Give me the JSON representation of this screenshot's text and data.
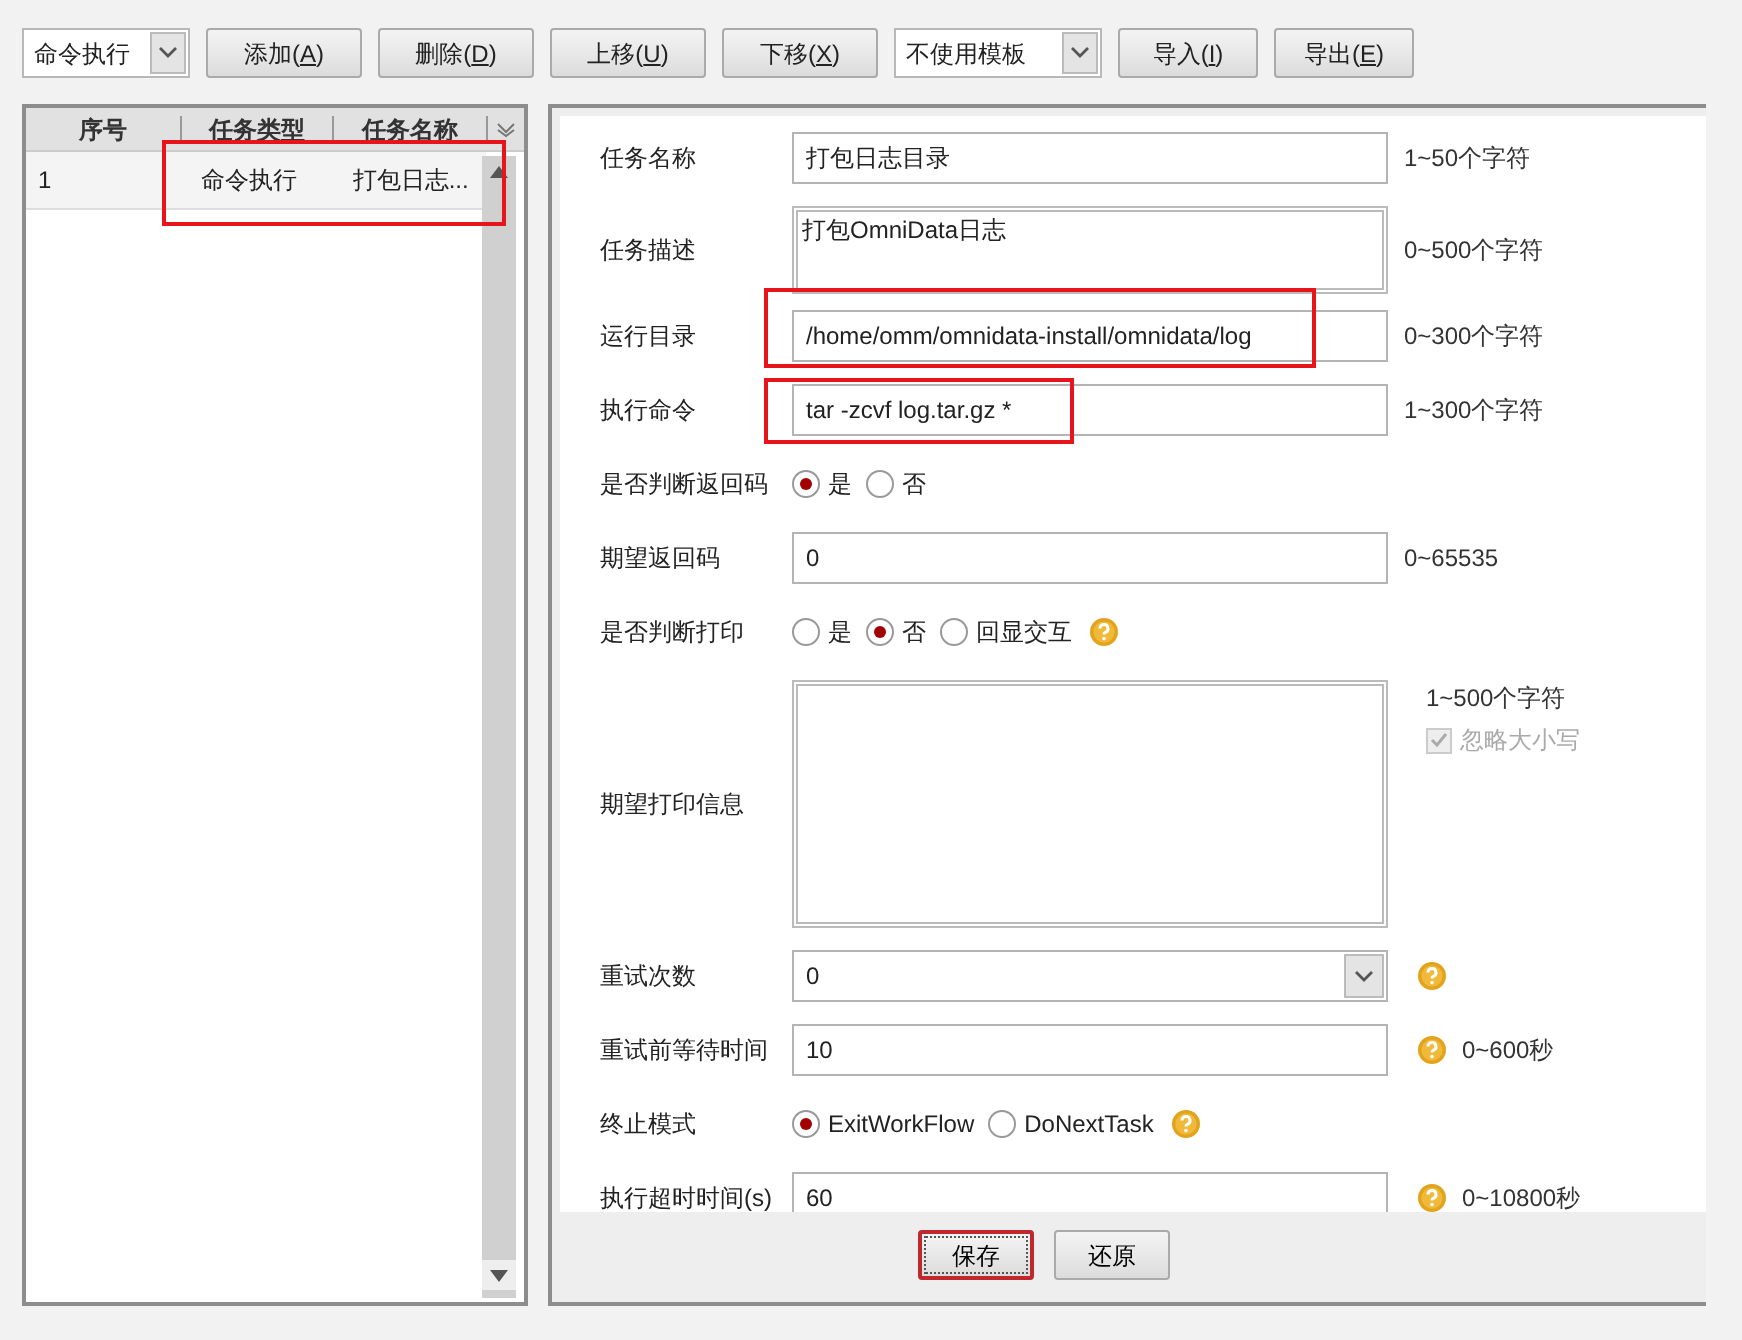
{
  "toolbar": {
    "type_select": {
      "value": "命令执行"
    },
    "buttons": [
      {
        "before": "添加(",
        "key": "A",
        "after": ")"
      },
      {
        "before": "删除(",
        "key": "D",
        "after": ")"
      },
      {
        "before": "上移(",
        "key": "U",
        "after": ")"
      },
      {
        "before": "下移(",
        "key": "X",
        "after": ")"
      }
    ],
    "template_select": {
      "value": "不使用模板"
    },
    "buttons_after": [
      {
        "before": "导入(",
        "key": "I",
        "after": ")"
      },
      {
        "before": "导出(",
        "key": "E",
        "after": ")"
      }
    ]
  },
  "task_table": {
    "columns": [
      "序号",
      "任务类型",
      "任务名称"
    ],
    "rows": [
      {
        "cells": [
          "1",
          "命令执行",
          "打包日志..."
        ],
        "selected": false,
        "annotated": true
      }
    ]
  },
  "form": {
    "rows": [
      {
        "kind": "text",
        "label": "任务名称",
        "value": "打包日志目录",
        "hint": "1~50个字符"
      },
      {
        "kind": "textarea",
        "label": "任务描述",
        "value": "打包OmniData日志",
        "hint": "0~500个字符"
      },
      {
        "kind": "text",
        "label": "运行目录",
        "value": "/home/omm/omnidata-install/omnidata/log",
        "hint": "0~300个字符",
        "annotated": true
      },
      {
        "kind": "text",
        "label": "执行命令",
        "value": "tar -zcvf log.tar.gz *",
        "hint": "1~300个字符",
        "annotated": true,
        "short_annotation": true
      },
      {
        "kind": "radio",
        "label": "是否判断返回码",
        "options": [
          {
            "label": "是",
            "selected": true
          },
          {
            "label": "否",
            "selected": false
          }
        ]
      },
      {
        "kind": "text",
        "label": "期望返回码",
        "value": "0",
        "hint": "0~65535"
      },
      {
        "kind": "radio",
        "label": "是否判断打印",
        "options": [
          {
            "label": "是",
            "selected": false
          },
          {
            "label": "否",
            "selected": true
          },
          {
            "label": "回显交互",
            "selected": false
          }
        ],
        "help": true
      },
      {
        "kind": "bigtext",
        "label": "期望打印信息",
        "value": "",
        "hint": "1~500个字符",
        "checkbox": {
          "label": "忽略大小写",
          "checked": true,
          "disabled": true
        }
      },
      {
        "kind": "select",
        "label": "重试次数",
        "value": "0",
        "help": true
      },
      {
        "kind": "text",
        "label": "重试前等待时间",
        "value": "10",
        "hint": "0~600秒",
        "help": true
      },
      {
        "kind": "radio",
        "label": "终止模式",
        "options": [
          {
            "label": "ExitWorkFlow",
            "selected": true
          },
          {
            "label": "DoNextTask",
            "selected": false
          }
        ],
        "help": true
      },
      {
        "kind": "text",
        "label": "执行超时时间(s)",
        "value": "60",
        "hint": "0~10800秒",
        "help": true
      }
    ]
  },
  "footer_buttons": [
    {
      "label": "保存",
      "focused": true
    },
    {
      "label": "还原",
      "focused": false
    }
  ]
}
